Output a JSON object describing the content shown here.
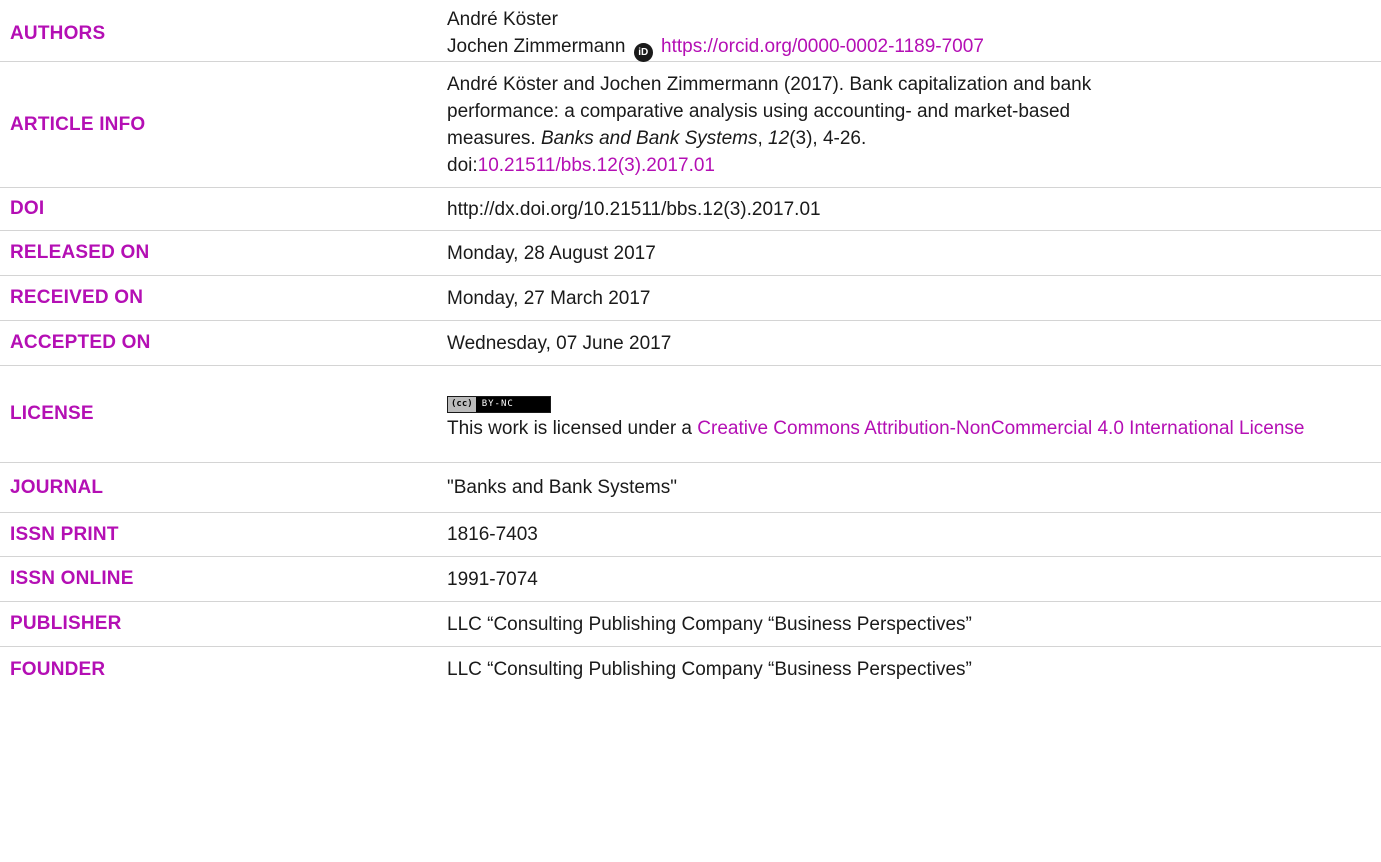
{
  "rows": {
    "authors": {
      "label": "AUTHORS",
      "author1": "André Köster",
      "author2": "Jochen Zimmermann",
      "orcid_url": "https://orcid.org/0000-0002-1189-7007"
    },
    "article_info": {
      "label": "ARTICLE INFO",
      "citation_prefix": "André Köster and Jochen Zimmermann (2017). Bank capitalization and bank performance: a comparative analysis using accounting- and market-based measures. ",
      "journal_italic": "Banks and Bank Systems",
      "sep1": ", ",
      "volume_italic": "12",
      "issue_pages": "(3), 4-26.",
      "doi_prefix": "doi:",
      "doi_link": "10.21511/bbs.12(3).2017.01"
    },
    "doi": {
      "label": "DOI",
      "value": "http://dx.doi.org/10.21511/bbs.12(3).2017.01"
    },
    "released_on": {
      "label": "RELEASED ON",
      "value": "Monday, 28 August 2017"
    },
    "received_on": {
      "label": "RECEIVED ON",
      "value": "Monday, 27 March 2017"
    },
    "accepted_on": {
      "label": "ACCEPTED ON",
      "value": "Wednesday, 07 June 2017"
    },
    "license": {
      "label": "LICENSE",
      "badge_left": "(cc)",
      "badge_right": "BY-NC",
      "text_prefix": "This work is licensed under a ",
      "license_link": "Creative Commons Attribution-NonCommercial 4.0 International License"
    },
    "journal": {
      "label": "JOURNAL",
      "value": "\"Banks and Bank Systems\""
    },
    "issn_print": {
      "label": "ISSN PRINT",
      "value": "1816-7403"
    },
    "issn_online": {
      "label": "ISSN ONLINE",
      "value": "1991-7074"
    },
    "publisher": {
      "label": "PUBLISHER",
      "value": "LLC “Consulting Publishing Company “Business Perspectives”"
    },
    "founder": {
      "label": "FOUNDER",
      "value": "LLC “Consulting Publishing Company “Business Perspectives”"
    }
  },
  "colors": {
    "label_color": "#b40fb4",
    "link_color": "#b40fb4",
    "text_color": "#1a1a1a",
    "divider_color": "#d4d4d4"
  },
  "icons": {
    "orcid": "orcid-id-icon",
    "license_badge": "cc-by-nc-badge"
  }
}
